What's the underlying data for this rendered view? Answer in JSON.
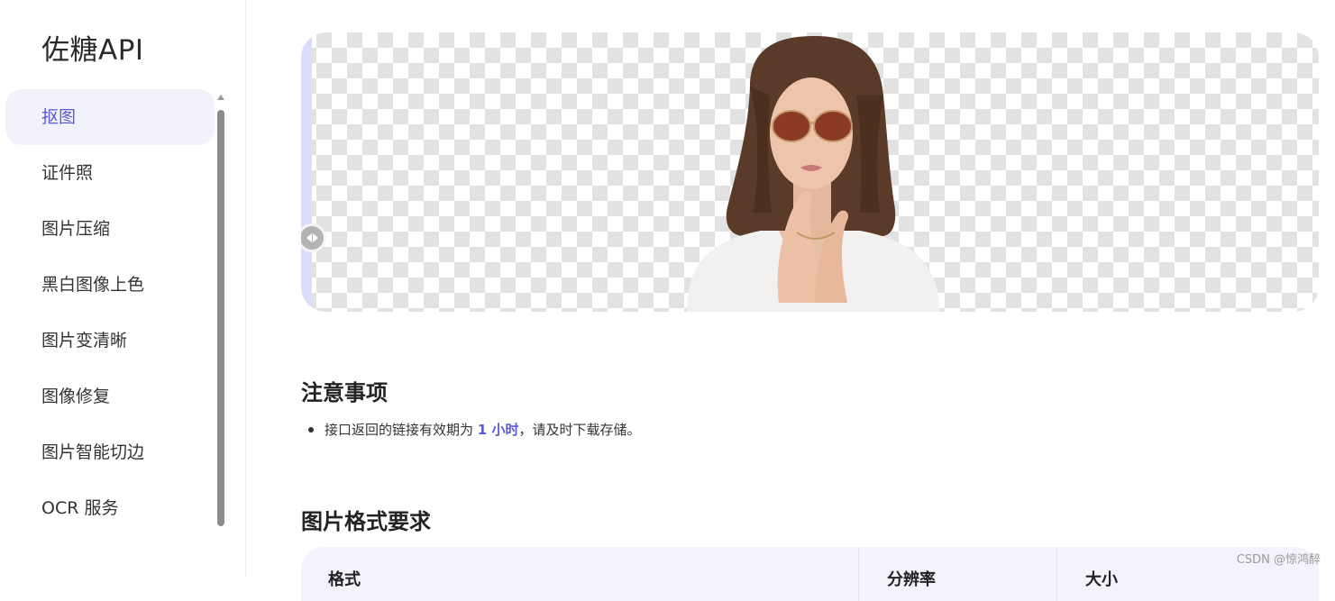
{
  "brand": {
    "title": "佐糖API"
  },
  "sidebar": {
    "items": [
      {
        "label": "抠图",
        "active": true
      },
      {
        "label": "证件照",
        "active": false
      },
      {
        "label": "图片压缩",
        "active": false
      },
      {
        "label": "黑白图像上色",
        "active": false
      },
      {
        "label": "图片变清晰",
        "active": false
      },
      {
        "label": "图像修复",
        "active": false
      },
      {
        "label": "图片智能切边",
        "active": false
      },
      {
        "label": "OCR 服务",
        "active": false
      }
    ]
  },
  "main": {
    "notes_title": "注意事项",
    "note": {
      "prefix": "接口返回的链接有效期为",
      "highlight": "1 小时",
      "suffix": "，请及时下载存储。"
    },
    "format_title": "图片格式要求",
    "table": {
      "headers": [
        "格式",
        "分辨率",
        "大小"
      ]
    }
  },
  "watermark": "CSDN @惊鸿醉",
  "colors": {
    "accent": "#5b5bd6",
    "active_bg": "#f2f2fd",
    "table_head_bg": "#f3f3fb",
    "checker": "#e2e2e2"
  },
  "icons": {
    "compare_handle": "compare-slider-handle-icon"
  }
}
